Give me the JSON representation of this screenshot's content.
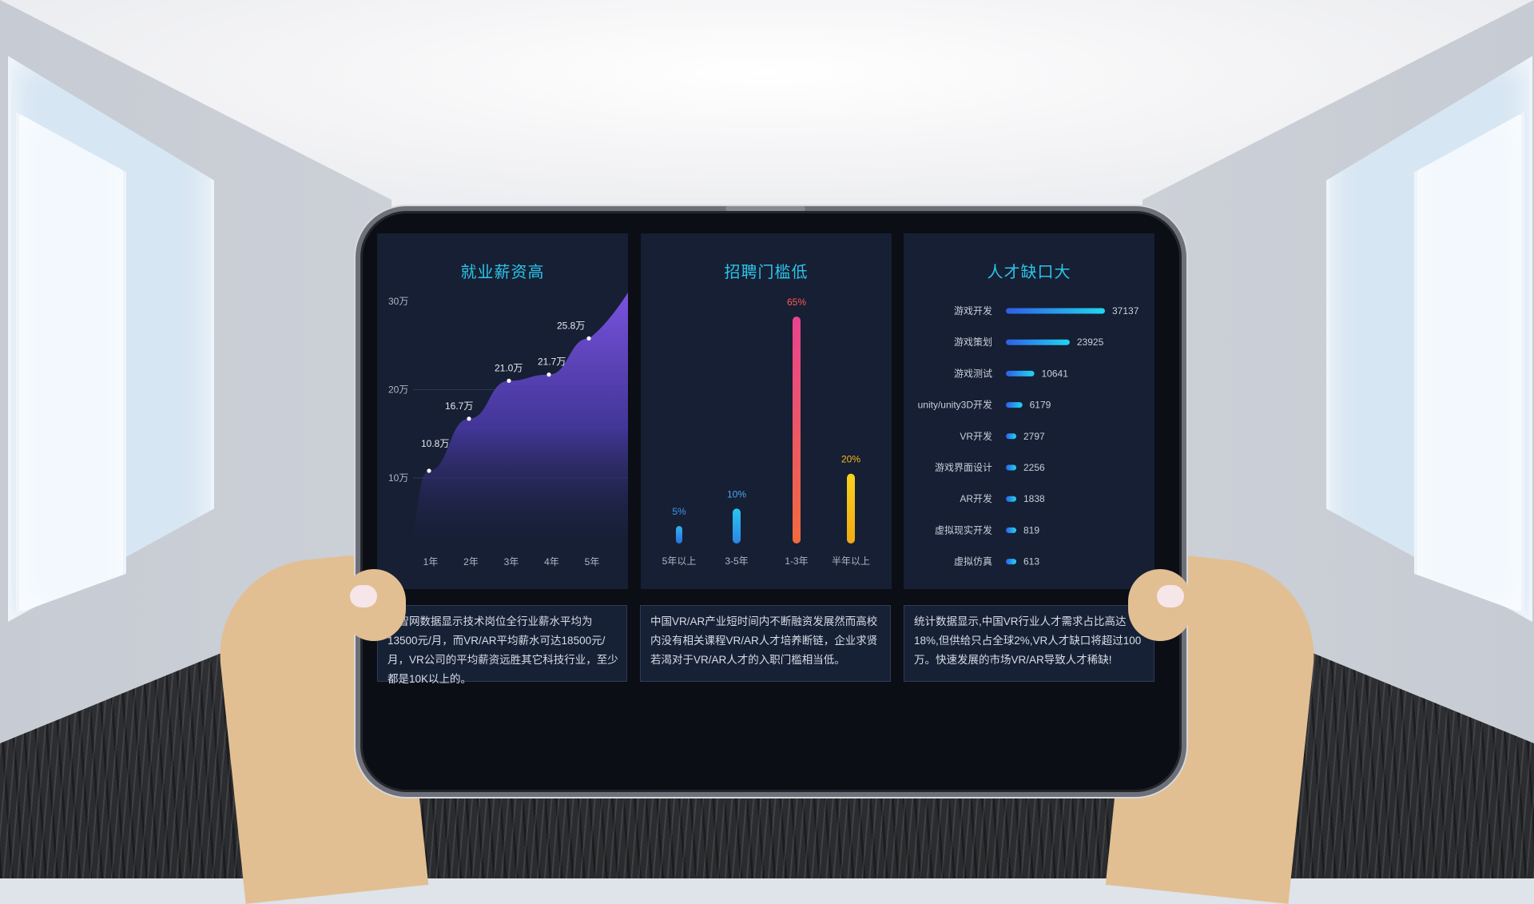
{
  "colors": {
    "panel_bg": "#161f33",
    "title": "#2cc4e8",
    "area_top": "#7a53e0",
    "area_bottom": "#1a2240",
    "bar_5pct": "#2b8fe8",
    "bar_10pct": "#27b3ef",
    "bar_65pct_top": "#e8438f",
    "bar_65pct_bottom": "#f0634a",
    "bar_20pct": "#f4c21a",
    "hbar_start": "#2e5fe8",
    "hbar_end": "#22d6f0"
  },
  "chart_data": [
    {
      "type": "area",
      "title": "就业薪资高",
      "x": [
        "1年",
        "2年",
        "3年",
        "4年",
        "5年"
      ],
      "y_ticks": [
        "10万",
        "20万",
        "30万"
      ],
      "ylim": [
        0,
        30
      ],
      "grid": true,
      "points": [
        {
          "x": "1年",
          "y": 10.8,
          "label": "10.8万"
        },
        {
          "x": "2年",
          "y": 16.7,
          "label": "16.7万"
        },
        {
          "x": "3年",
          "y": 21.0,
          "label": "21.0万"
        },
        {
          "x": "4年",
          "y": 21.7,
          "label": "21.7万"
        },
        {
          "x": "5年",
          "y": 25.8,
          "label": "25.8万"
        }
      ]
    },
    {
      "type": "bar",
      "title": "招聘门槛低",
      "categories": [
        "5年以上",
        "3-5年",
        "1-3年",
        "半年以上"
      ],
      "values": [
        5,
        10,
        65,
        20
      ],
      "labels": [
        "5%",
        "10%",
        "65%",
        "20%"
      ],
      "label_colors": [
        "#3e96f0",
        "#4aa6f3",
        "#ff5a52",
        "#f6b81c"
      ]
    },
    {
      "type": "bar",
      "orientation": "horizontal",
      "title": "人才缺口大",
      "categories": [
        "游戏开发",
        "游戏策划",
        "游戏测试",
        "unity/unity3D开发",
        "VR开发",
        "游戏界面设计",
        "AR开发",
        "虚拟现实开发",
        "虚拟仿真"
      ],
      "values": [
        37137,
        23925,
        10641,
        6179,
        2797,
        2256,
        1838,
        819,
        613
      ]
    }
  ],
  "descriptions": [
    "极智网数据显示技术岗位全行业薪水平均为13500元/月，而VR/AR平均薪水可达18500元/月，VR公司的平均薪资远胜其它科技行业，至少都是10K以上的。",
    "中国VR/AR产业短时间内不断融资发展然而高校内没有相关课程VR/AR人才培养断链，企业求贤若渴对于VR/AR人才的入职门槛相当低。",
    "统计数据显示,中国VR行业人才需求占比高达18%,但供给只占全球2%,VR人才缺口将超过100万。快速发展的市场VR/AR导致人才稀缺!"
  ]
}
